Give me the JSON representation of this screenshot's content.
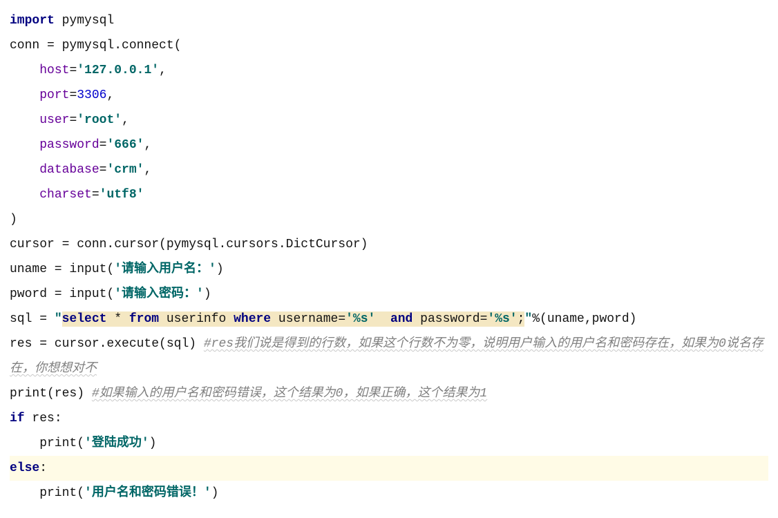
{
  "code": {
    "l1_import": "import",
    "l1_mod": " pymysql",
    "l2": "conn = pymysql.connect(",
    "l3_param": "host",
    "l3_eq": "=",
    "l3_str": "'127.0.0.1'",
    "l3_comma": ",",
    "l4_param": "port",
    "l4_eq": "=",
    "l4_num": "3306",
    "l4_comma": ",",
    "l5_param": "user",
    "l5_eq": "=",
    "l5_str": "'root'",
    "l5_comma": ",",
    "l6_param": "password",
    "l6_eq": "=",
    "l6_str": "'666'",
    "l6_comma": ",",
    "l7_param": "database",
    "l7_eq": "=",
    "l7_str": "'crm'",
    "l7_comma": ",",
    "l8_param": "charset",
    "l8_eq": "=",
    "l8_str": "'utf8'",
    "l9": ")",
    "l10": "cursor = conn.cursor(pymysql.cursors.DictCursor)",
    "l11_a": "uname = input(",
    "l11_str": "'请输入用户名：'",
    "l11_b": ")",
    "l12_a": "pword = input(",
    "l12_str": "'请输入密码：'",
    "l12_b": ")",
    "l13_a": "sql = ",
    "l13_q1": "\"",
    "l13_kw1": "select ",
    "l13_star": "* ",
    "l13_kw2": "from ",
    "l13_tbl": "userinfo ",
    "l13_kw3": "where ",
    "l13_col1": "username=",
    "l13_fmt1": "'%s'",
    "l13_and_sp1": " ",
    "l13_and": " and ",
    "l13_col2": "password=",
    "l13_fmt2": "'%s'",
    "l13_semi": ";",
    "l13_q2": "\"",
    "l13_b": "%(uname,pword)",
    "l14_a": "res = cursor.execute(sql) ",
    "l14_comment": "#res我们说是得到的行数，如果这个行数不为零，说明用户输入的用户名和密码存在，如果为0说名存在，你想想对不",
    "l15_a": "print(res) ",
    "l15_comment": "#如果输入的用户名和密码错误，这个结果为0，如果正确，这个结果为1",
    "l16_if": "if",
    "l16_rest": " res:",
    "l17_a": "    print(",
    "l17_str": "'登陆成功'",
    "l17_b": ")",
    "l18_else": "else",
    "l18_colon": ":",
    "l19_a": "    print(",
    "l19_str": "'用户名和密码错误！'",
    "l19_b": ")"
  }
}
